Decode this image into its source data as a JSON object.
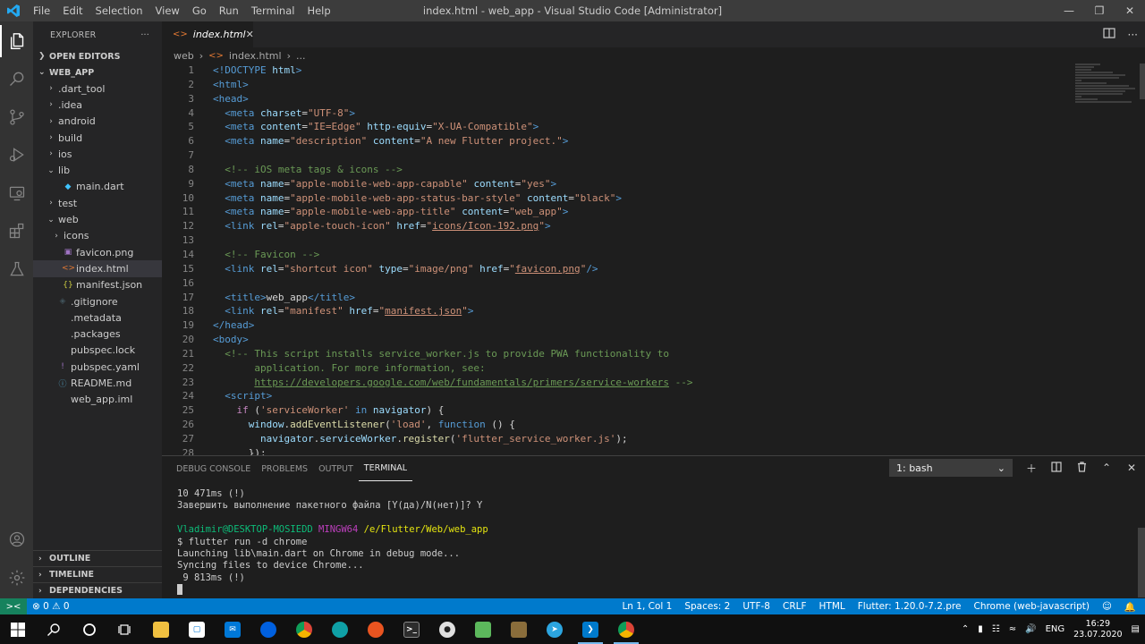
{
  "window": {
    "title": "index.html - web_app - Visual Studio Code [Administrator]",
    "menu": [
      "File",
      "Edit",
      "Selection",
      "View",
      "Go",
      "Run",
      "Terminal",
      "Help"
    ]
  },
  "activity_bar": {
    "items": [
      "explorer-icon",
      "search-icon",
      "source-control-icon",
      "run-debug-icon",
      "remote-explorer-icon",
      "extensions-icon",
      "testing-flask-icon"
    ],
    "bottom": [
      "account-icon",
      "settings-gear-icon"
    ]
  },
  "explorer": {
    "header": "EXPLORER",
    "more": "···",
    "open_editors": "OPEN EDITORS",
    "project": "WEB_APP",
    "tree": [
      {
        "label": ".dart_tool",
        "type": "folder",
        "depth": 1
      },
      {
        "label": ".idea",
        "type": "folder",
        "depth": 1
      },
      {
        "label": "android",
        "type": "folder",
        "depth": 1
      },
      {
        "label": "build",
        "type": "folder",
        "depth": 1
      },
      {
        "label": "ios",
        "type": "folder",
        "depth": 1
      },
      {
        "label": "lib",
        "type": "folder-open",
        "depth": 1
      },
      {
        "label": "main.dart",
        "type": "dart",
        "depth": 2
      },
      {
        "label": "test",
        "type": "folder",
        "depth": 1
      },
      {
        "label": "web",
        "type": "folder-open",
        "depth": 1
      },
      {
        "label": "icons",
        "type": "folder",
        "depth": 2
      },
      {
        "label": "favicon.png",
        "type": "image",
        "depth": 2
      },
      {
        "label": "index.html",
        "type": "html",
        "depth": 2,
        "selected": true
      },
      {
        "label": "manifest.json",
        "type": "json",
        "depth": 2
      },
      {
        "label": ".gitignore",
        "type": "git",
        "depth": 1
      },
      {
        "label": ".metadata",
        "type": "file",
        "depth": 1
      },
      {
        "label": ".packages",
        "type": "file",
        "depth": 1
      },
      {
        "label": "pubspec.lock",
        "type": "file",
        "depth": 1
      },
      {
        "label": "pubspec.yaml",
        "type": "yaml",
        "depth": 1
      },
      {
        "label": "README.md",
        "type": "info",
        "depth": 1
      },
      {
        "label": "web_app.iml",
        "type": "iml",
        "depth": 1
      }
    ],
    "bottom_sections": [
      "OUTLINE",
      "TIMELINE",
      "DEPENDENCIES"
    ]
  },
  "editor": {
    "tab_label": "index.html",
    "tab_close": "✕",
    "breadcrumb": [
      "web",
      "index.html",
      "..."
    ],
    "lines": [
      [
        [
          "tag",
          "<!DOCTYPE "
        ],
        [
          "attr",
          "html"
        ],
        [
          "tag",
          ">"
        ]
      ],
      [
        [
          "tag",
          "<html>"
        ]
      ],
      [
        [
          "tag",
          "<head>"
        ]
      ],
      [
        [
          "txt",
          "  "
        ],
        [
          "tag",
          "<meta "
        ],
        [
          "attr",
          "charset"
        ],
        [
          "txt",
          "="
        ],
        [
          "str",
          "\"UTF-8\""
        ],
        [
          "tag",
          ">"
        ]
      ],
      [
        [
          "txt",
          "  "
        ],
        [
          "tag",
          "<meta "
        ],
        [
          "attr",
          "content"
        ],
        [
          "txt",
          "="
        ],
        [
          "str",
          "\"IE=Edge\""
        ],
        [
          "txt",
          " "
        ],
        [
          "attr",
          "http-equiv"
        ],
        [
          "txt",
          "="
        ],
        [
          "str",
          "\"X-UA-Compatible\""
        ],
        [
          "tag",
          ">"
        ]
      ],
      [
        [
          "txt",
          "  "
        ],
        [
          "tag",
          "<meta "
        ],
        [
          "attr",
          "name"
        ],
        [
          "txt",
          "="
        ],
        [
          "str",
          "\"description\""
        ],
        [
          "txt",
          " "
        ],
        [
          "attr",
          "content"
        ],
        [
          "txt",
          "="
        ],
        [
          "str",
          "\"A new Flutter project.\""
        ],
        [
          "tag",
          ">"
        ]
      ],
      [
        [
          "txt",
          ""
        ]
      ],
      [
        [
          "txt",
          "  "
        ],
        [
          "com",
          "<!-- iOS meta tags & icons -->"
        ]
      ],
      [
        [
          "txt",
          "  "
        ],
        [
          "tag",
          "<meta "
        ],
        [
          "attr",
          "name"
        ],
        [
          "txt",
          "="
        ],
        [
          "str",
          "\"apple-mobile-web-app-capable\""
        ],
        [
          "txt",
          " "
        ],
        [
          "attr",
          "content"
        ],
        [
          "txt",
          "="
        ],
        [
          "str",
          "\"yes\""
        ],
        [
          "tag",
          ">"
        ]
      ],
      [
        [
          "txt",
          "  "
        ],
        [
          "tag",
          "<meta "
        ],
        [
          "attr",
          "name"
        ],
        [
          "txt",
          "="
        ],
        [
          "str",
          "\"apple-mobile-web-app-status-bar-style\""
        ],
        [
          "txt",
          " "
        ],
        [
          "attr",
          "content"
        ],
        [
          "txt",
          "="
        ],
        [
          "str",
          "\"black\""
        ],
        [
          "tag",
          ">"
        ]
      ],
      [
        [
          "txt",
          "  "
        ],
        [
          "tag",
          "<meta "
        ],
        [
          "attr",
          "name"
        ],
        [
          "txt",
          "="
        ],
        [
          "str",
          "\"apple-mobile-web-app-title\""
        ],
        [
          "txt",
          " "
        ],
        [
          "attr",
          "content"
        ],
        [
          "txt",
          "="
        ],
        [
          "str",
          "\"web_app\""
        ],
        [
          "tag",
          ">"
        ]
      ],
      [
        [
          "txt",
          "  "
        ],
        [
          "tag",
          "<link "
        ],
        [
          "attr",
          "rel"
        ],
        [
          "txt",
          "="
        ],
        [
          "str",
          "\"apple-touch-icon\""
        ],
        [
          "txt",
          " "
        ],
        [
          "attr",
          "href"
        ],
        [
          "txt",
          "="
        ],
        [
          "str",
          "\""
        ],
        [
          "stru",
          "icons/Icon-192.png"
        ],
        [
          "str",
          "\""
        ],
        [
          "tag",
          ">"
        ]
      ],
      [
        [
          "txt",
          ""
        ]
      ],
      [
        [
          "txt",
          "  "
        ],
        [
          "com",
          "<!-- Favicon -->"
        ]
      ],
      [
        [
          "txt",
          "  "
        ],
        [
          "tag",
          "<link "
        ],
        [
          "attr",
          "rel"
        ],
        [
          "txt",
          "="
        ],
        [
          "str",
          "\"shortcut icon\""
        ],
        [
          "txt",
          " "
        ],
        [
          "attr",
          "type"
        ],
        [
          "txt",
          "="
        ],
        [
          "str",
          "\"image/png\""
        ],
        [
          "txt",
          " "
        ],
        [
          "attr",
          "href"
        ],
        [
          "txt",
          "="
        ],
        [
          "str",
          "\""
        ],
        [
          "stru",
          "favicon.png"
        ],
        [
          "str",
          "\""
        ],
        [
          "tag",
          "/>"
        ]
      ],
      [
        [
          "txt",
          ""
        ]
      ],
      [
        [
          "txt",
          "  "
        ],
        [
          "tag",
          "<title>"
        ],
        [
          "txt",
          "web_app"
        ],
        [
          "tag",
          "</title>"
        ]
      ],
      [
        [
          "txt",
          "  "
        ],
        [
          "tag",
          "<link "
        ],
        [
          "attr",
          "rel"
        ],
        [
          "txt",
          "="
        ],
        [
          "str",
          "\"manifest\""
        ],
        [
          "txt",
          " "
        ],
        [
          "attr",
          "href"
        ],
        [
          "txt",
          "="
        ],
        [
          "str",
          "\""
        ],
        [
          "stru",
          "manifest.json"
        ],
        [
          "str",
          "\""
        ],
        [
          "tag",
          ">"
        ]
      ],
      [
        [
          "tag",
          "</head>"
        ]
      ],
      [
        [
          "tag",
          "<body>"
        ]
      ],
      [
        [
          "txt",
          "  "
        ],
        [
          "com",
          "<!-- This script installs service_worker.js to provide PWA functionality to"
        ]
      ],
      [
        [
          "com",
          "       application. For more information, see:"
        ]
      ],
      [
        [
          "com",
          "       "
        ],
        [
          "comu",
          "https://developers.google.com/web/fundamentals/primers/service-workers"
        ],
        [
          "com",
          " -->"
        ]
      ],
      [
        [
          "txt",
          "  "
        ],
        [
          "tag",
          "<script>"
        ]
      ],
      [
        [
          "txt",
          "    "
        ],
        [
          "kw",
          "if"
        ],
        [
          "txt",
          " ("
        ],
        [
          "str",
          "'serviceWorker'"
        ],
        [
          "txt",
          " "
        ],
        [
          "func",
          "in"
        ],
        [
          "txt",
          " "
        ],
        [
          "attr",
          "navigator"
        ],
        [
          "txt",
          ") {"
        ]
      ],
      [
        [
          "txt",
          "      "
        ],
        [
          "attr",
          "window"
        ],
        [
          "txt",
          "."
        ],
        [
          "fn",
          "addEventListener"
        ],
        [
          "txt",
          "("
        ],
        [
          "str",
          "'load'"
        ],
        [
          "txt",
          ", "
        ],
        [
          "func",
          "function"
        ],
        [
          "txt",
          " () {"
        ]
      ],
      [
        [
          "txt",
          "        "
        ],
        [
          "attr",
          "navigator"
        ],
        [
          "txt",
          "."
        ],
        [
          "attr",
          "serviceWorker"
        ],
        [
          "txt",
          "."
        ],
        [
          "fn",
          "register"
        ],
        [
          "txt",
          "("
        ],
        [
          "str",
          "'flutter_service_worker.js'"
        ],
        [
          "txt",
          ");"
        ]
      ],
      [
        [
          "txt",
          "      });"
        ]
      ]
    ]
  },
  "panel": {
    "tabs": [
      "DEBUG CONSOLE",
      "PROBLEMS",
      "OUTPUT",
      "TERMINAL"
    ],
    "active_tab": "TERMINAL",
    "terminal_select": "1: bash",
    "terminal_lines": [
      [
        [
          "plain",
          "10 471ms (!)"
        ]
      ],
      [
        [
          "plain",
          "Завершить выполнение пакетного файла [Y(да)/N(нет)]? Y"
        ]
      ],
      [
        [
          "plain",
          ""
        ]
      ],
      [
        [
          "green",
          "Vladimir@DESKTOP-MOSIEDD "
        ],
        [
          "magenta",
          "MINGW64 "
        ],
        [
          "yellow",
          "/e/Flutter/Web/web_app"
        ]
      ],
      [
        [
          "plain",
          "$ flutter run -d chrome"
        ]
      ],
      [
        [
          "plain",
          "Launching lib\\main.dart on Chrome in debug mode..."
        ]
      ],
      [
        [
          "plain",
          "Syncing files to device Chrome..."
        ]
      ],
      [
        [
          "plain",
          " 9 813ms (!)"
        ]
      ]
    ]
  },
  "statusbar": {
    "remote": "><",
    "problems": "⊗ 0 ⚠ 0",
    "position": "Ln 1, Col 1",
    "spaces": "Spaces: 2",
    "encoding": "UTF-8",
    "eol": "CRLF",
    "language": "HTML",
    "flutter": "Flutter: 1.20.0-7.2.pre",
    "device": "Chrome (web-javascript)"
  },
  "taskbar": {
    "language": "ENG",
    "time": "16:29",
    "date": "23.07.2020"
  },
  "colors": {
    "accent": "#007acc",
    "titlebar": "#3c3c3c",
    "activitybar": "#333333",
    "sidebar": "#252526",
    "editor": "#1e1e1e"
  }
}
